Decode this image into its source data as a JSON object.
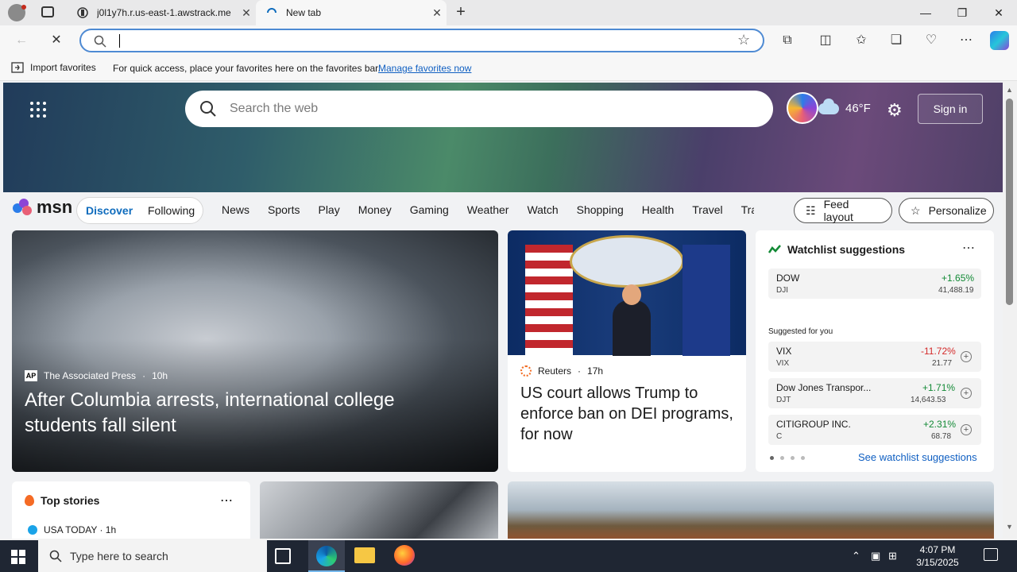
{
  "browser": {
    "tabs": [
      {
        "title": "j0l1y7h.r.us-east-1.awstrack.me",
        "active": false
      },
      {
        "title": "New tab",
        "active": true
      }
    ],
    "address_value": "",
    "favorites_bar": {
      "import_label": "Import favorites",
      "message": "For quick access, place your favorites here on the favorites bar.",
      "manage_link": "Manage favorites now"
    }
  },
  "msn_header": {
    "search_placeholder": "Search the web",
    "temperature": "46°F",
    "sign_in": "Sign in"
  },
  "msn_nav": {
    "logo": "msn",
    "pill": [
      "Discover",
      "Following"
    ],
    "links": [
      "News",
      "Sports",
      "Play",
      "Money",
      "Gaming",
      "Weather",
      "Watch",
      "Shopping",
      "Health",
      "Travel",
      "Tra"
    ],
    "feed_layout": "Feed layout",
    "personalize": "Personalize"
  },
  "cards": {
    "main": {
      "source": "The Associated Press",
      "ap_logo": "AP",
      "age": "10h",
      "headline": "After Columbia arrests, international college students fall silent"
    },
    "doj": {
      "source": "Reuters",
      "age": "17h",
      "headline": "US court allows Trump to enforce ban on DEI programs, for now"
    },
    "watchlist": {
      "title": "Watchlist suggestions",
      "suggested_label": "Suggested for you",
      "see_more": "See watchlist suggestions",
      "stocks": [
        {
          "name": "DOW",
          "ticker": "DJI",
          "change": "+1.65%",
          "price": "41,488.19",
          "dir": "up"
        },
        {
          "name": "VIX",
          "ticker": "VIX",
          "change": "-11.72%",
          "price": "21.77",
          "dir": "down"
        },
        {
          "name": "Dow Jones Transpor...",
          "ticker": "DJT",
          "change": "+1.71%",
          "price": "14,643.53",
          "dir": "up"
        },
        {
          "name": "CITIGROUP INC.",
          "ticker": "C",
          "change": "+2.31%",
          "price": "68.78",
          "dir": "up"
        }
      ]
    },
    "top_stories": {
      "title": "Top stories",
      "source": "USA TODAY · 1h"
    }
  },
  "taskbar": {
    "search_placeholder": "Type here to search",
    "time": "4:07 PM",
    "date": "3/15/2025"
  }
}
